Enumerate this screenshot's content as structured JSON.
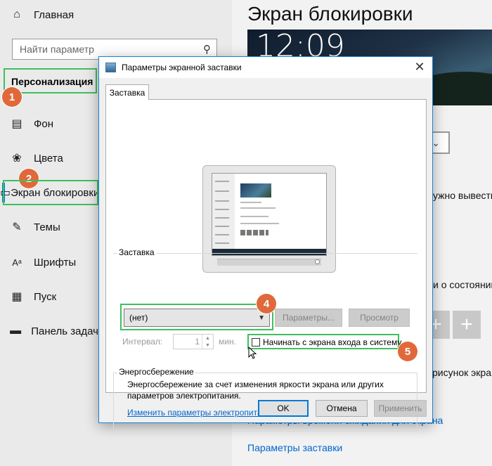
{
  "sidebar": {
    "home_label": "Главная",
    "search_placeholder": "Найти параметр",
    "section_title": "Персонализация",
    "items": [
      {
        "label": "Фон",
        "icon": "image-icon"
      },
      {
        "label": "Цвета",
        "icon": "palette-icon"
      },
      {
        "label": "Экран блокировки",
        "icon": "lock-screen-icon"
      },
      {
        "label": "Темы",
        "icon": "themes-icon"
      },
      {
        "label": "Шрифты",
        "icon": "fonts-icon"
      },
      {
        "label": "Пуск",
        "icon": "start-icon"
      },
      {
        "label": "Панель задач",
        "icon": "taskbar-icon"
      }
    ]
  },
  "page": {
    "title": "Экран блокировки",
    "preview_time": "12:09",
    "text_1": "ужно вывести",
    "text_2": "и о состоянии",
    "text_3": "рисунок экра",
    "link_1": "Параметры времени ожидания для экрана",
    "link_2": "Параметры заставки"
  },
  "dialog": {
    "title": "Параметры экранной заставки",
    "tab": "Заставка",
    "screensaver_group": "Заставка",
    "screensaver_value": "(нет)",
    "settings_button": "Параметры...",
    "preview_button": "Просмотр",
    "interval_label": "Интервал:",
    "interval_value": "1",
    "interval_unit": "мин.",
    "logon_checkbox_label": "Начинать с экрана входа в систему",
    "logon_checked": false,
    "power_group": "Энергосбережение",
    "power_text": "Энергосбережение за счет изменения яркости экрана или других параметров электропитания.",
    "power_link": "Изменить параметры электропитания",
    "ok_button": "OK",
    "cancel_button": "Отмена",
    "apply_button": "Применить"
  },
  "annotations": {
    "step_1": "1",
    "step_2": "2",
    "step_4": "4",
    "step_5": "5",
    "highlight_color": "#3fbf5f",
    "marker_color": "#e0693b"
  },
  "colors": {
    "accent": "#0078d7",
    "link": "#0066cc"
  }
}
